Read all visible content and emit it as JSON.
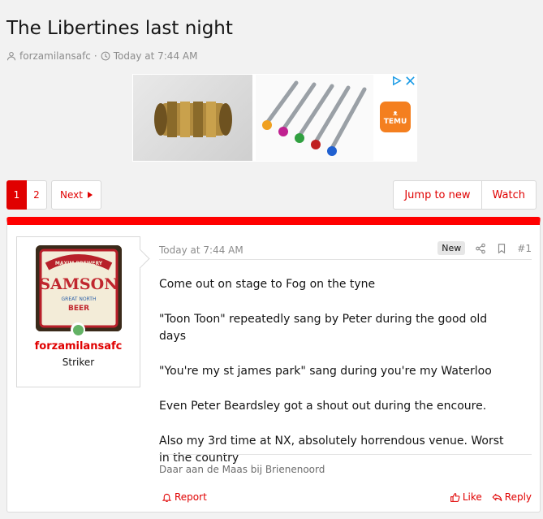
{
  "thread": {
    "title": "The Libertines last night",
    "author": "forzamilansafc",
    "separator": "·",
    "time": "Today at 7:44 AM"
  },
  "ad": {
    "brand": "TEMU",
    "icons": [
      "adchoices-icon",
      "close-icon"
    ]
  },
  "pagination": {
    "current": "1",
    "page2": "2",
    "next_label": "Next"
  },
  "actions": {
    "jump_label": "Jump to new",
    "watch_label": "Watch"
  },
  "post": {
    "username": "forzamilansafc",
    "user_title": "Striker",
    "date": "Today at 7:44 AM",
    "new_badge": "New",
    "post_number": "#1",
    "message": [
      "Come out on stage to Fog on the tyne",
      "\"Toon Toon\" repeatedly sang by Peter during the good old days",
      "\"You're my st james park\" sang during you're my Waterloo",
      "Even Peter Beardsley got a shout out during the encoure.",
      "Also my 3rd time at NX, absolutely horrendous venue. Worst in the country"
    ],
    "signature": "Daar aan de Maas bij Brienenoord",
    "report_label": "Report",
    "like_label": "Like",
    "reply_label": "Reply",
    "avatar_text": [
      "MAXIM BREWERY",
      "SAMSON",
      "GREAT NORTH",
      "BEER"
    ]
  },
  "colors": {
    "accent": "#e00000",
    "post_top_bar": "#ff0000",
    "online": "#63b265"
  }
}
